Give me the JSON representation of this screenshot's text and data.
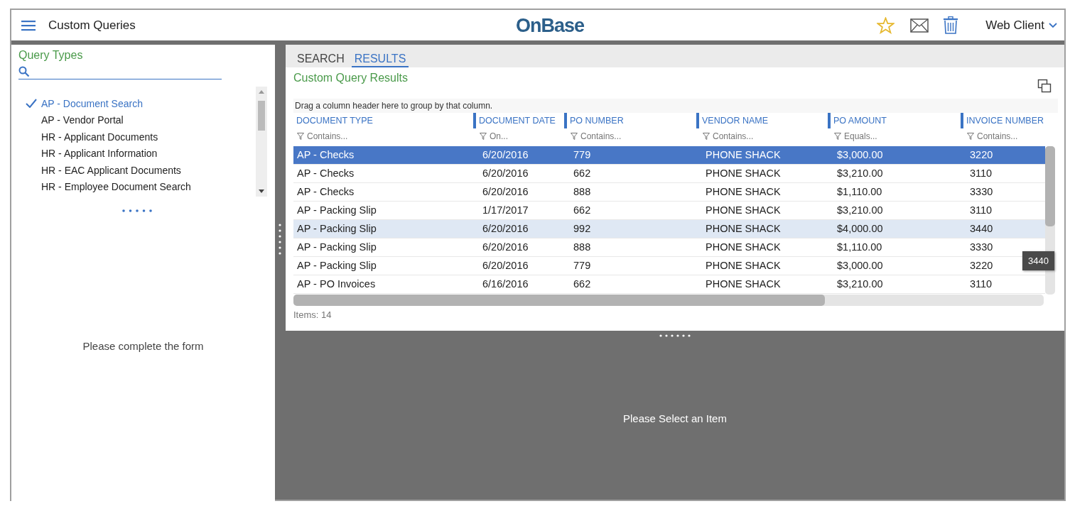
{
  "header": {
    "title": "Custom Queries",
    "logo": "OnBase",
    "user_menu": "Web Client"
  },
  "query_panel": {
    "title": "Query Types",
    "items": [
      {
        "label": "AP - Document Search",
        "selected": true
      },
      {
        "label": "AP - Vendor Portal",
        "selected": false
      },
      {
        "label": "HR - Applicant Documents",
        "selected": false
      },
      {
        "label": "HR - Applicant Information",
        "selected": false
      },
      {
        "label": "HR - EAC Applicant Documents",
        "selected": false
      },
      {
        "label": "HR - Employee Document Search",
        "selected": false
      }
    ],
    "message": "Please complete the form"
  },
  "results": {
    "tabs": [
      {
        "label": "SEARCH",
        "selected": false
      },
      {
        "label": "RESULTS",
        "selected": true
      }
    ],
    "title": "Custom Query Results",
    "group_hint": "Drag a column header here to group by that column.",
    "columns": [
      {
        "label": "DOCUMENT TYPE",
        "filter": "Contains..."
      },
      {
        "label": "DOCUMENT DATE",
        "filter": "On..."
      },
      {
        "label": "PO NUMBER",
        "filter": "Contains..."
      },
      {
        "label": "VENDOR NAME",
        "filter": "Contains..."
      },
      {
        "label": "PO AMOUNT",
        "filter": "Equals..."
      },
      {
        "label": "INVOICE NUMBER",
        "filter": "Contains..."
      }
    ],
    "rows": [
      {
        "cells": [
          "AP - Checks",
          "6/20/2016",
          "779",
          "PHONE SHACK",
          "$3,000.00",
          "3220"
        ],
        "selected": true,
        "hovered": false
      },
      {
        "cells": [
          "AP - Checks",
          "6/20/2016",
          "662",
          "PHONE SHACK",
          "$3,210.00",
          "3110"
        ],
        "selected": false,
        "hovered": false
      },
      {
        "cells": [
          "AP - Checks",
          "6/20/2016",
          "888",
          "PHONE SHACK",
          "$1,110.00",
          "3330"
        ],
        "selected": false,
        "hovered": false
      },
      {
        "cells": [
          "AP - Packing Slip",
          "1/17/2017",
          "662",
          "PHONE SHACK",
          "$3,210.00",
          "3110"
        ],
        "selected": false,
        "hovered": false
      },
      {
        "cells": [
          "AP - Packing Slip",
          "6/20/2016",
          "992",
          "PHONE SHACK",
          "$4,000.00",
          "3440"
        ],
        "selected": false,
        "hovered": true
      },
      {
        "cells": [
          "AP - Packing Slip",
          "6/20/2016",
          "888",
          "PHONE SHACK",
          "$1,110.00",
          "3330"
        ],
        "selected": false,
        "hovered": false
      },
      {
        "cells": [
          "AP - Packing Slip",
          "6/20/2016",
          "779",
          "PHONE SHACK",
          "$3,000.00",
          "3220"
        ],
        "selected": false,
        "hovered": false
      },
      {
        "cells": [
          "AP - PO Invoices",
          "6/16/2016",
          "662",
          "PHONE SHACK",
          "$3,210.00",
          "3110"
        ],
        "selected": false,
        "hovered": false
      }
    ],
    "tooltip": "3440",
    "items_count": "Items: 14"
  },
  "detail": {
    "message": "Please Select an Item"
  }
}
